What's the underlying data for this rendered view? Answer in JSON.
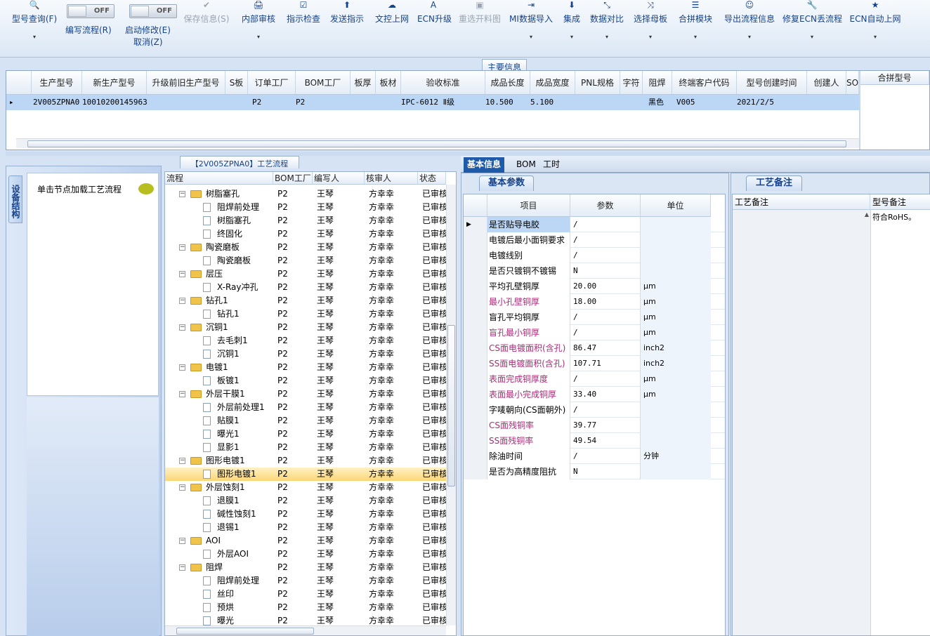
{
  "toolbar": {
    "items": [
      {
        "icon": "🔍",
        "label": "型号查询(F)",
        "disabled": false
      },
      {
        "icon": "✔",
        "label": "保存信息(S)",
        "disabled": true
      },
      {
        "icon": "🖨",
        "label": "内部审核",
        "disabled": false
      },
      {
        "icon": "☑",
        "label": "指示检查",
        "disabled": false
      },
      {
        "icon": "⬆",
        "label": "发送指示",
        "disabled": false
      },
      {
        "icon": "☁",
        "label": "文控上网",
        "disabled": false
      },
      {
        "icon": "A",
        "label": "ECN升级",
        "disabled": false
      },
      {
        "icon": "▣",
        "label": "重选开料图",
        "disabled": true
      },
      {
        "icon": "⇥",
        "label": "MI数据导入",
        "disabled": false
      },
      {
        "icon": "⬇",
        "label": "集成",
        "disabled": false
      },
      {
        "icon": "⤡",
        "label": "数据对比",
        "disabled": false
      },
      {
        "icon": "⤨",
        "label": "选择母板",
        "disabled": false
      },
      {
        "icon": "☰",
        "label": "合拼模块",
        "disabled": false
      },
      {
        "icon": "☺",
        "label": "导出流程信息",
        "disabled": false
      },
      {
        "icon": "🔧",
        "label": "修复ECN丢流程",
        "disabled": false
      },
      {
        "icon": "★",
        "label": "ECN自动上网",
        "disabled": false
      }
    ],
    "toggle1": {
      "state": "OFF",
      "label": "编写流程(R)"
    },
    "toggle2": {
      "state": "OFF",
      "label": "启动修改(E)",
      "label2": "取消(Z)"
    }
  },
  "main_info": {
    "caption": "主要信息",
    "columns": [
      "生产型号",
      "新生产型号",
      "升级前旧生产型号",
      "S板",
      "订单工厂",
      "BOM工厂",
      "板厚",
      "板材",
      "验收标准",
      "成品长度",
      "成品宽度",
      "PNL规格",
      "字符",
      "阻焊",
      "终端客户代码",
      "型号创建时间",
      "创建人",
      "SO"
    ],
    "row": [
      "2V005ZPNA0",
      "10010200145963",
      "",
      "",
      "P2",
      "P2",
      "",
      "",
      "IPC-6012 Ⅱ级",
      "10.500",
      "5.100",
      "",
      "",
      "黑色",
      "V005",
      "2021/2/5",
      "",
      ""
    ],
    "side_header": "合拼型号"
  },
  "left_panel": {
    "vtab": "设备结构",
    "node_hint": "单击节点加载工艺流程"
  },
  "process": {
    "caption": "【2V005ZPNA0】工艺流程",
    "columns": [
      "流程",
      "BOM工厂",
      "编写人",
      "核审人",
      "状态"
    ],
    "rows": [
      {
        "level": 0,
        "name": "树脂塞孔",
        "bom": "P2",
        "writer": "王琴",
        "reviewer": "方幸幸",
        "status": "已审核"
      },
      {
        "level": 1,
        "name": "阻焊前处理",
        "bom": "P2",
        "writer": "王琴",
        "reviewer": "方幸幸",
        "status": "已审核"
      },
      {
        "level": 1,
        "name": "树脂塞孔",
        "bom": "P2",
        "writer": "王琴",
        "reviewer": "方幸幸",
        "status": "已审核"
      },
      {
        "level": 1,
        "name": "终固化",
        "bom": "P2",
        "writer": "王琴",
        "reviewer": "方幸幸",
        "status": "已审核"
      },
      {
        "level": 0,
        "name": "陶瓷磨板",
        "bom": "P2",
        "writer": "王琴",
        "reviewer": "方幸幸",
        "status": "已审核"
      },
      {
        "level": 1,
        "name": "陶瓷磨板",
        "bom": "P2",
        "writer": "王琴",
        "reviewer": "方幸幸",
        "status": "已审核"
      },
      {
        "level": 0,
        "name": "层压",
        "bom": "P2",
        "writer": "王琴",
        "reviewer": "方幸幸",
        "status": "已审核"
      },
      {
        "level": 1,
        "name": "X-Ray冲孔",
        "bom": "P2",
        "writer": "王琴",
        "reviewer": "方幸幸",
        "status": "已审核"
      },
      {
        "level": 0,
        "name": "钻孔1",
        "bom": "P2",
        "writer": "王琴",
        "reviewer": "方幸幸",
        "status": "已审核"
      },
      {
        "level": 1,
        "name": "钻孔1",
        "bom": "P2",
        "writer": "王琴",
        "reviewer": "方幸幸",
        "status": "已审核"
      },
      {
        "level": 0,
        "name": "沉铜1",
        "bom": "P2",
        "writer": "王琴",
        "reviewer": "方幸幸",
        "status": "已审核"
      },
      {
        "level": 1,
        "name": "去毛刺1",
        "bom": "P2",
        "writer": "王琴",
        "reviewer": "方幸幸",
        "status": "已审核"
      },
      {
        "level": 1,
        "name": "沉铜1",
        "bom": "P2",
        "writer": "王琴",
        "reviewer": "方幸幸",
        "status": "已审核"
      },
      {
        "level": 0,
        "name": "电镀1",
        "bom": "P2",
        "writer": "王琴",
        "reviewer": "方幸幸",
        "status": "已审核"
      },
      {
        "level": 1,
        "name": "板镀1",
        "bom": "P2",
        "writer": "王琴",
        "reviewer": "方幸幸",
        "status": "已审核"
      },
      {
        "level": 0,
        "name": "外层干膜1",
        "bom": "P2",
        "writer": "王琴",
        "reviewer": "方幸幸",
        "status": "已审核"
      },
      {
        "level": 1,
        "name": "外层前处理1",
        "bom": "P2",
        "writer": "王琴",
        "reviewer": "方幸幸",
        "status": "已审核"
      },
      {
        "level": 1,
        "name": "贴膜1",
        "bom": "P2",
        "writer": "王琴",
        "reviewer": "方幸幸",
        "status": "已审核"
      },
      {
        "level": 1,
        "name": "曝光1",
        "bom": "P2",
        "writer": "王琴",
        "reviewer": "方幸幸",
        "status": "已审核"
      },
      {
        "level": 1,
        "name": "显影1",
        "bom": "P2",
        "writer": "王琴",
        "reviewer": "方幸幸",
        "status": "已审核"
      },
      {
        "level": 0,
        "name": "图形电镀1",
        "bom": "P2",
        "writer": "王琴",
        "reviewer": "方幸幸",
        "status": "已审核"
      },
      {
        "level": 1,
        "name": "图形电镀1",
        "bom": "P2",
        "writer": "王琴",
        "reviewer": "方幸幸",
        "status": "已审核",
        "selected": true
      },
      {
        "level": 0,
        "name": "外层蚀刻1",
        "bom": "P2",
        "writer": "王琴",
        "reviewer": "方幸幸",
        "status": "已审核"
      },
      {
        "level": 1,
        "name": "退膜1",
        "bom": "P2",
        "writer": "王琴",
        "reviewer": "方幸幸",
        "status": "已审核"
      },
      {
        "level": 1,
        "name": "碱性蚀刻1",
        "bom": "P2",
        "writer": "王琴",
        "reviewer": "方幸幸",
        "status": "已审核"
      },
      {
        "level": 1,
        "name": "退锡1",
        "bom": "P2",
        "writer": "王琴",
        "reviewer": "方幸幸",
        "status": "已审核"
      },
      {
        "level": 0,
        "name": "AOI",
        "bom": "P2",
        "writer": "王琴",
        "reviewer": "方幸幸",
        "status": "已审核"
      },
      {
        "level": 1,
        "name": "外层AOI",
        "bom": "P2",
        "writer": "王琴",
        "reviewer": "方幸幸",
        "status": "已审核"
      },
      {
        "level": 0,
        "name": "阻焊",
        "bom": "P2",
        "writer": "王琴",
        "reviewer": "方幸幸",
        "status": "已审核"
      },
      {
        "level": 1,
        "name": "阻焊前处理",
        "bom": "P2",
        "writer": "王琴",
        "reviewer": "方幸幸",
        "status": "已审核"
      },
      {
        "level": 1,
        "name": "丝印",
        "bom": "P2",
        "writer": "王琴",
        "reviewer": "方幸幸",
        "status": "已审核"
      },
      {
        "level": 1,
        "name": "预烘",
        "bom": "P2",
        "writer": "王琴",
        "reviewer": "方幸幸",
        "status": "已审核"
      },
      {
        "level": 1,
        "name": "曝光",
        "bom": "P2",
        "writer": "王琴",
        "reviewer": "方幸幸",
        "status": "已审核"
      }
    ]
  },
  "detail_tabs": [
    "基本信息",
    "BOM",
    "工时"
  ],
  "basic_params": {
    "tab": "基本参数",
    "columns": [
      "项目",
      "参数",
      "单位"
    ],
    "rows": [
      {
        "item": "是否贴导电胶",
        "value": "/",
        "unit": "",
        "pink": false
      },
      {
        "item": "电镀后最小面铜要求",
        "value": "/",
        "unit": "",
        "pink": false
      },
      {
        "item": "电镀线别",
        "value": "/",
        "unit": "",
        "pink": false
      },
      {
        "item": "是否只镀铜不镀锡",
        "value": "N",
        "unit": "",
        "pink": false
      },
      {
        "item": "平均孔壁铜厚",
        "value": "20.00",
        "unit": "μm",
        "pink": false
      },
      {
        "item": "最小孔壁铜厚",
        "value": "18.00",
        "unit": "μm",
        "pink": true
      },
      {
        "item": "盲孔平均铜厚",
        "value": "/",
        "unit": "μm",
        "pink": false
      },
      {
        "item": "盲孔最小铜厚",
        "value": "/",
        "unit": "μm",
        "pink": true
      },
      {
        "item": "CS面电镀面积(含孔)",
        "value": "86.47",
        "unit": "inch2",
        "pink": true
      },
      {
        "item": "SS面电镀面积(含孔)",
        "value": "107.71",
        "unit": "inch2",
        "pink": true
      },
      {
        "item": "表面完成铜厚度",
        "value": "/",
        "unit": "μm",
        "pink": true
      },
      {
        "item": "表面最小完成铜厚",
        "value": "33.40",
        "unit": "μm",
        "pink": true
      },
      {
        "item": "字唛朝向(CS面朝外)",
        "value": "/",
        "unit": "",
        "pink": false
      },
      {
        "item": "CS面残铜率",
        "value": "39.77",
        "unit": "",
        "pink": true
      },
      {
        "item": "SS面残铜率",
        "value": "49.54",
        "unit": "",
        "pink": true
      },
      {
        "item": "除油时间",
        "value": "/",
        "unit": "分钟",
        "pink": false
      },
      {
        "item": "是否为高精度阻抗",
        "value": "N",
        "unit": "",
        "pink": false
      }
    ]
  },
  "remarks": {
    "tab": "工艺备注",
    "col1": "工艺备注",
    "col2": "型号备注",
    "model_remark": "符合RoHS。"
  }
}
